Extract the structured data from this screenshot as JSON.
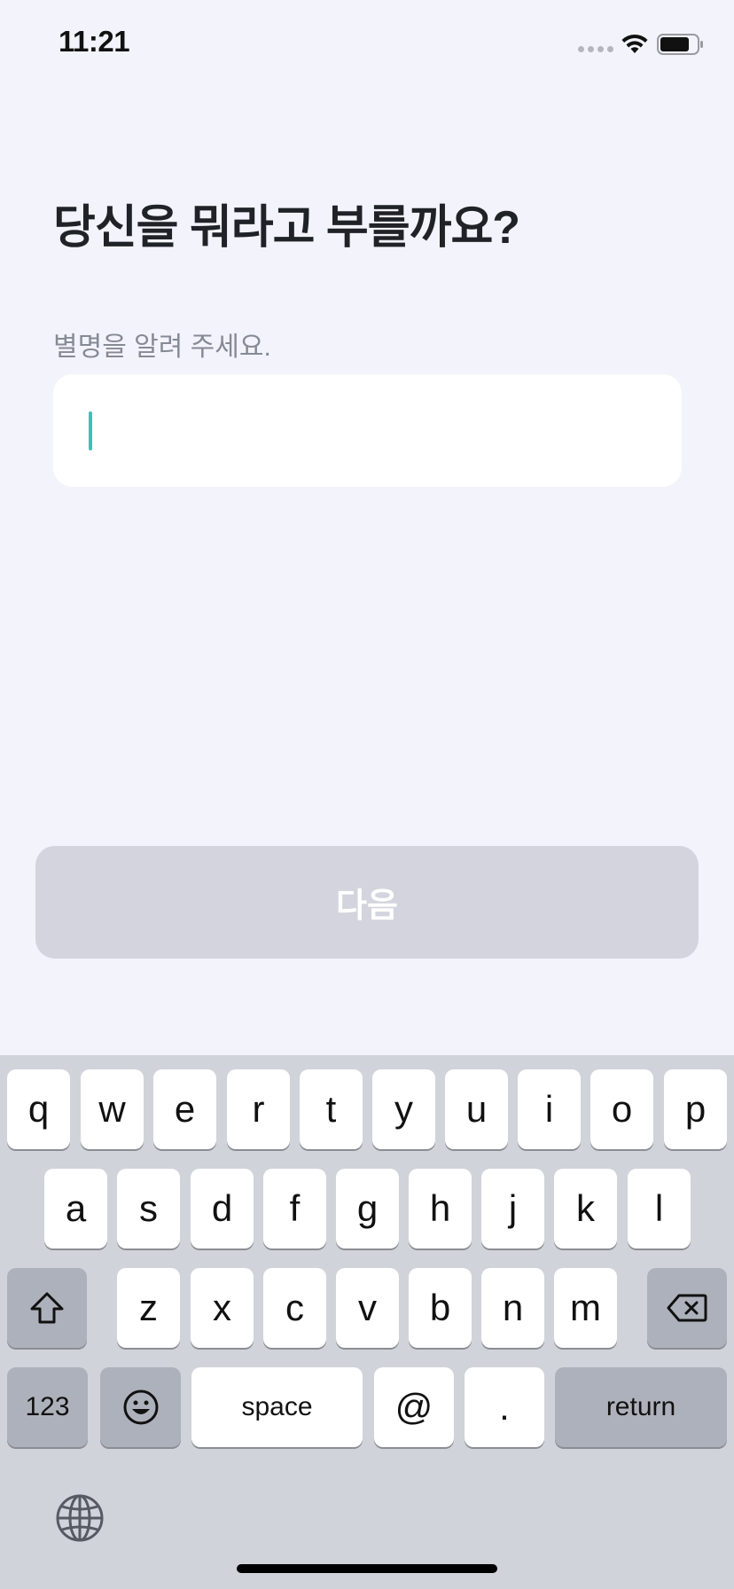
{
  "status_bar": {
    "time": "11:21"
  },
  "onboarding": {
    "title": "당신을 뭐라고 부를까요?",
    "subtitle": "별명을 알려 주세요.",
    "nickname_value": "",
    "next_label": "다음"
  },
  "keyboard": {
    "row1": [
      "q",
      "w",
      "e",
      "r",
      "t",
      "y",
      "u",
      "i",
      "o",
      "p"
    ],
    "row2": [
      "a",
      "s",
      "d",
      "f",
      "g",
      "h",
      "j",
      "k",
      "l"
    ],
    "row3": [
      "z",
      "x",
      "c",
      "v",
      "b",
      "n",
      "m"
    ],
    "numbers_label": "123",
    "space_label": "space",
    "at_label": "@",
    "period_label": ".",
    "return_label": "return"
  },
  "colors": {
    "background": "#f3f3fb",
    "caret": "#3fc2b6",
    "button_disabled": "#d3d4dd",
    "keyboard_bg": "#d1d3da"
  },
  "icons": [
    "wifi-icon",
    "battery-icon",
    "shift-icon",
    "backspace-icon",
    "emoji-icon",
    "globe-icon"
  ]
}
